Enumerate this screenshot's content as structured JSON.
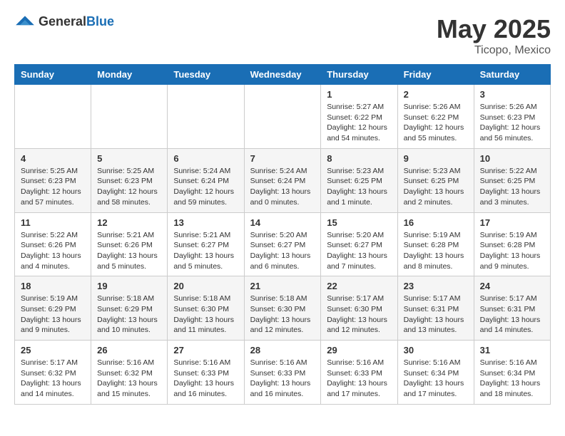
{
  "header": {
    "logo_general": "General",
    "logo_blue": "Blue",
    "month": "May 2025",
    "location": "Ticopo, Mexico"
  },
  "weekdays": [
    "Sunday",
    "Monday",
    "Tuesday",
    "Wednesday",
    "Thursday",
    "Friday",
    "Saturday"
  ],
  "weeks": [
    [
      {
        "day": "",
        "info": ""
      },
      {
        "day": "",
        "info": ""
      },
      {
        "day": "",
        "info": ""
      },
      {
        "day": "",
        "info": ""
      },
      {
        "day": "1",
        "info": "Sunrise: 5:27 AM\nSunset: 6:22 PM\nDaylight: 12 hours\nand 54 minutes."
      },
      {
        "day": "2",
        "info": "Sunrise: 5:26 AM\nSunset: 6:22 PM\nDaylight: 12 hours\nand 55 minutes."
      },
      {
        "day": "3",
        "info": "Sunrise: 5:26 AM\nSunset: 6:23 PM\nDaylight: 12 hours\nand 56 minutes."
      }
    ],
    [
      {
        "day": "4",
        "info": "Sunrise: 5:25 AM\nSunset: 6:23 PM\nDaylight: 12 hours\nand 57 minutes."
      },
      {
        "day": "5",
        "info": "Sunrise: 5:25 AM\nSunset: 6:23 PM\nDaylight: 12 hours\nand 58 minutes."
      },
      {
        "day": "6",
        "info": "Sunrise: 5:24 AM\nSunset: 6:24 PM\nDaylight: 12 hours\nand 59 minutes."
      },
      {
        "day": "7",
        "info": "Sunrise: 5:24 AM\nSunset: 6:24 PM\nDaylight: 13 hours\nand 0 minutes."
      },
      {
        "day": "8",
        "info": "Sunrise: 5:23 AM\nSunset: 6:25 PM\nDaylight: 13 hours\nand 1 minute."
      },
      {
        "day": "9",
        "info": "Sunrise: 5:23 AM\nSunset: 6:25 PM\nDaylight: 13 hours\nand 2 minutes."
      },
      {
        "day": "10",
        "info": "Sunrise: 5:22 AM\nSunset: 6:25 PM\nDaylight: 13 hours\nand 3 minutes."
      }
    ],
    [
      {
        "day": "11",
        "info": "Sunrise: 5:22 AM\nSunset: 6:26 PM\nDaylight: 13 hours\nand 4 minutes."
      },
      {
        "day": "12",
        "info": "Sunrise: 5:21 AM\nSunset: 6:26 PM\nDaylight: 13 hours\nand 5 minutes."
      },
      {
        "day": "13",
        "info": "Sunrise: 5:21 AM\nSunset: 6:27 PM\nDaylight: 13 hours\nand 5 minutes."
      },
      {
        "day": "14",
        "info": "Sunrise: 5:20 AM\nSunset: 6:27 PM\nDaylight: 13 hours\nand 6 minutes."
      },
      {
        "day": "15",
        "info": "Sunrise: 5:20 AM\nSunset: 6:27 PM\nDaylight: 13 hours\nand 7 minutes."
      },
      {
        "day": "16",
        "info": "Sunrise: 5:19 AM\nSunset: 6:28 PM\nDaylight: 13 hours\nand 8 minutes."
      },
      {
        "day": "17",
        "info": "Sunrise: 5:19 AM\nSunset: 6:28 PM\nDaylight: 13 hours\nand 9 minutes."
      }
    ],
    [
      {
        "day": "18",
        "info": "Sunrise: 5:19 AM\nSunset: 6:29 PM\nDaylight: 13 hours\nand 9 minutes."
      },
      {
        "day": "19",
        "info": "Sunrise: 5:18 AM\nSunset: 6:29 PM\nDaylight: 13 hours\nand 10 minutes."
      },
      {
        "day": "20",
        "info": "Sunrise: 5:18 AM\nSunset: 6:30 PM\nDaylight: 13 hours\nand 11 minutes."
      },
      {
        "day": "21",
        "info": "Sunrise: 5:18 AM\nSunset: 6:30 PM\nDaylight: 13 hours\nand 12 minutes."
      },
      {
        "day": "22",
        "info": "Sunrise: 5:17 AM\nSunset: 6:30 PM\nDaylight: 13 hours\nand 12 minutes."
      },
      {
        "day": "23",
        "info": "Sunrise: 5:17 AM\nSunset: 6:31 PM\nDaylight: 13 hours\nand 13 minutes."
      },
      {
        "day": "24",
        "info": "Sunrise: 5:17 AM\nSunset: 6:31 PM\nDaylight: 13 hours\nand 14 minutes."
      }
    ],
    [
      {
        "day": "25",
        "info": "Sunrise: 5:17 AM\nSunset: 6:32 PM\nDaylight: 13 hours\nand 14 minutes."
      },
      {
        "day": "26",
        "info": "Sunrise: 5:16 AM\nSunset: 6:32 PM\nDaylight: 13 hours\nand 15 minutes."
      },
      {
        "day": "27",
        "info": "Sunrise: 5:16 AM\nSunset: 6:33 PM\nDaylight: 13 hours\nand 16 minutes."
      },
      {
        "day": "28",
        "info": "Sunrise: 5:16 AM\nSunset: 6:33 PM\nDaylight: 13 hours\nand 16 minutes."
      },
      {
        "day": "29",
        "info": "Sunrise: 5:16 AM\nSunset: 6:33 PM\nDaylight: 13 hours\nand 17 minutes."
      },
      {
        "day": "30",
        "info": "Sunrise: 5:16 AM\nSunset: 6:34 PM\nDaylight: 13 hours\nand 17 minutes."
      },
      {
        "day": "31",
        "info": "Sunrise: 5:16 AM\nSunset: 6:34 PM\nDaylight: 13 hours\nand 18 minutes."
      }
    ]
  ]
}
